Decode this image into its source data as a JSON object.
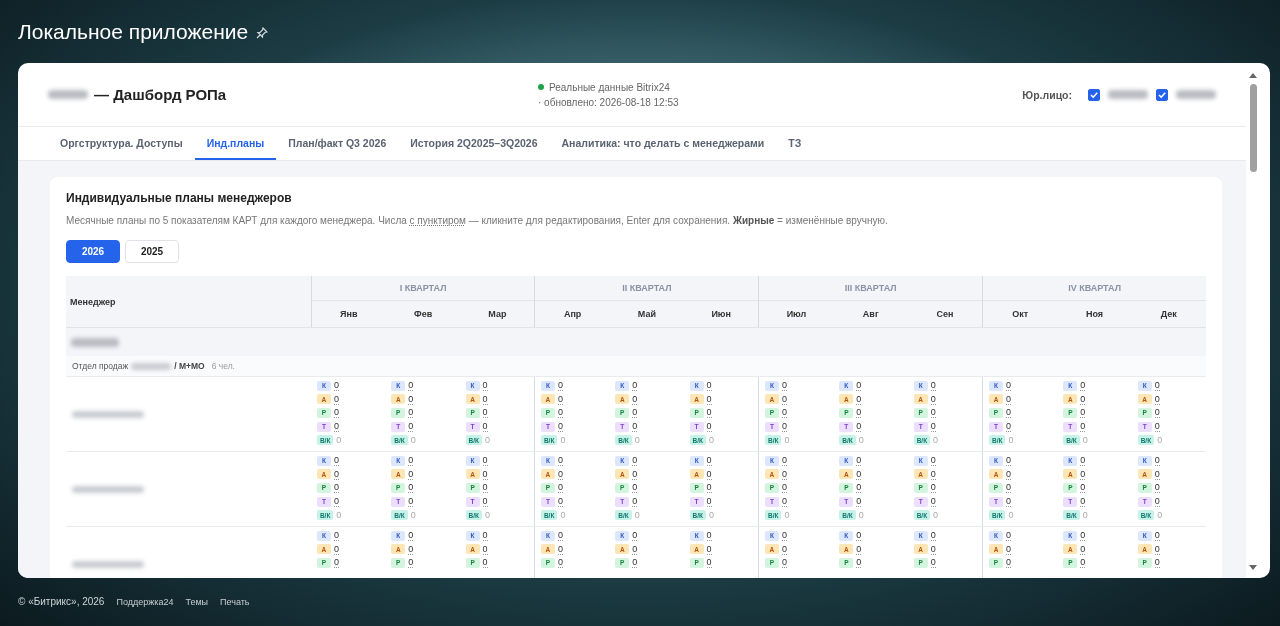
{
  "page_title": "Локальное приложение",
  "header": {
    "title": "— Дашборд РОПа",
    "status": {
      "text": "Реальные данные Bitrix24",
      "color": "#1fa34a"
    },
    "updated": "· обновлено: 2026-08-18 12:53",
    "legal_label": "Юр.лицо:",
    "legal_entities": [
      {
        "checked": true
      },
      {
        "checked": true
      }
    ]
  },
  "tabs": [
    {
      "label": "Оргструктура. Доступы",
      "selected": false
    },
    {
      "label": "Инд.планы",
      "selected": true
    },
    {
      "label": "План/факт Q3 2026",
      "selected": false
    },
    {
      "label": "История 2Q2025–3Q2026",
      "selected": false
    },
    {
      "label": "Аналитика: что делать с менеджерами",
      "selected": false
    },
    {
      "label": "ТЗ",
      "selected": false
    }
  ],
  "panel": {
    "title": "Индивидуальные планы менеджеров",
    "description": [
      {
        "kind": "plain",
        "text": "Месячные планы по 5 показателям КАРТ для каждого менеджера. Числа "
      },
      {
        "kind": "dotted",
        "text": "с пунктиром"
      },
      {
        "kind": "plain",
        "text": " — кликните для редактирования, Enter для сохранения. "
      },
      {
        "kind": "bold",
        "text": "Жирные"
      },
      {
        "kind": "plain",
        "text": " = изменённые вручную."
      }
    ],
    "years": [
      {
        "label": "2026",
        "selected": true
      },
      {
        "label": "2025",
        "selected": false
      }
    ]
  },
  "table": {
    "manager_header": "Менеджер",
    "quarters": [
      {
        "label": "I КВАРТАЛ",
        "months": [
          "Янв",
          "Фев",
          "Мар"
        ]
      },
      {
        "label": "II КВАРТАЛ",
        "months": [
          "Апр",
          "Май",
          "Июн"
        ]
      },
      {
        "label": "III КВАРТАЛ",
        "months": [
          "Июл",
          "Авг",
          "Сен"
        ]
      },
      {
        "label": "IV КВАРТАЛ",
        "months": [
          "Окт",
          "Ноя",
          "Дек"
        ]
      }
    ],
    "department": {
      "prefix": "Отдел продаж",
      "suffix": "/ М+МО",
      "count": "6 чел."
    },
    "managers": [
      {
        "months": [
          [
            {
              "kind": "k",
              "label": "К",
              "value": "0"
            },
            {
              "kind": "a",
              "label": "А",
              "value": "0"
            },
            {
              "kind": "r",
              "label": "Р",
              "value": "0"
            },
            {
              "kind": "t",
              "label": "Т",
              "value": "0"
            },
            {
              "kind": "vk",
              "label": "В/К",
              "value": "0"
            }
          ],
          [
            {
              "kind": "k",
              "label": "К",
              "value": "0"
            },
            {
              "kind": "a",
              "label": "А",
              "value": "0"
            },
            {
              "kind": "r",
              "label": "Р",
              "value": "0"
            },
            {
              "kind": "t",
              "label": "Т",
              "value": "0"
            },
            {
              "kind": "vk",
              "label": "В/К",
              "value": "0"
            }
          ],
          [
            {
              "kind": "k",
              "label": "К",
              "value": "0"
            },
            {
              "kind": "a",
              "label": "А",
              "value": "0"
            },
            {
              "kind": "r",
              "label": "Р",
              "value": "0"
            },
            {
              "kind": "t",
              "label": "Т",
              "value": "0"
            },
            {
              "kind": "vk",
              "label": "В/К",
              "value": "0"
            }
          ],
          [
            {
              "kind": "k",
              "label": "К",
              "value": "0"
            },
            {
              "kind": "a",
              "label": "А",
              "value": "0"
            },
            {
              "kind": "r",
              "label": "Р",
              "value": "0"
            },
            {
              "kind": "t",
              "label": "Т",
              "value": "0"
            },
            {
              "kind": "vk",
              "label": "В/К",
              "value": "0"
            }
          ],
          [
            {
              "kind": "k",
              "label": "К",
              "value": "0"
            },
            {
              "kind": "a",
              "label": "А",
              "value": "0"
            },
            {
              "kind": "r",
              "label": "Р",
              "value": "0"
            },
            {
              "kind": "t",
              "label": "Т",
              "value": "0"
            },
            {
              "kind": "vk",
              "label": "В/К",
              "value": "0"
            }
          ],
          [
            {
              "kind": "k",
              "label": "К",
              "value": "0"
            },
            {
              "kind": "a",
              "label": "А",
              "value": "0"
            },
            {
              "kind": "r",
              "label": "Р",
              "value": "0"
            },
            {
              "kind": "t",
              "label": "Т",
              "value": "0"
            },
            {
              "kind": "vk",
              "label": "В/К",
              "value": "0"
            }
          ],
          [
            {
              "kind": "k",
              "label": "К",
              "value": "0"
            },
            {
              "kind": "a",
              "label": "А",
              "value": "0"
            },
            {
              "kind": "r",
              "label": "Р",
              "value": "0"
            },
            {
              "kind": "t",
              "label": "Т",
              "value": "0"
            },
            {
              "kind": "vk",
              "label": "В/К",
              "value": "0"
            }
          ],
          [
            {
              "kind": "k",
              "label": "К",
              "value": "0"
            },
            {
              "kind": "a",
              "label": "А",
              "value": "0"
            },
            {
              "kind": "r",
              "label": "Р",
              "value": "0"
            },
            {
              "kind": "t",
              "label": "Т",
              "value": "0"
            },
            {
              "kind": "vk",
              "label": "В/К",
              "value": "0"
            }
          ],
          [
            {
              "kind": "k",
              "label": "К",
              "value": "0"
            },
            {
              "kind": "a",
              "label": "А",
              "value": "0"
            },
            {
              "kind": "r",
              "label": "Р",
              "value": "0"
            },
            {
              "kind": "t",
              "label": "Т",
              "value": "0"
            },
            {
              "kind": "vk",
              "label": "В/К",
              "value": "0"
            }
          ],
          [
            {
              "kind": "k",
              "label": "К",
              "value": "0"
            },
            {
              "kind": "a",
              "label": "А",
              "value": "0"
            },
            {
              "kind": "r",
              "label": "Р",
              "value": "0"
            },
            {
              "kind": "t",
              "label": "Т",
              "value": "0"
            },
            {
              "kind": "vk",
              "label": "В/К",
              "value": "0"
            }
          ],
          [
            {
              "kind": "k",
              "label": "К",
              "value": "0"
            },
            {
              "kind": "a",
              "label": "А",
              "value": "0"
            },
            {
              "kind": "r",
              "label": "Р",
              "value": "0"
            },
            {
              "kind": "t",
              "label": "Т",
              "value": "0"
            },
            {
              "kind": "vk",
              "label": "В/К",
              "value": "0"
            }
          ],
          [
            {
              "kind": "k",
              "label": "К",
              "value": "0"
            },
            {
              "kind": "a",
              "label": "А",
              "value": "0"
            },
            {
              "kind": "r",
              "label": "Р",
              "value": "0"
            },
            {
              "kind": "t",
              "label": "Т",
              "value": "0"
            },
            {
              "kind": "vk",
              "label": "В/К",
              "value": "0"
            }
          ]
        ]
      },
      {
        "months": [
          [
            {
              "kind": "k",
              "label": "К",
              "value": "0"
            },
            {
              "kind": "a",
              "label": "А",
              "value": "0"
            },
            {
              "kind": "r",
              "label": "Р",
              "value": "0"
            },
            {
              "kind": "t",
              "label": "Т",
              "value": "0"
            },
            {
              "kind": "vk",
              "label": "В/К",
              "value": "0"
            }
          ],
          [
            {
              "kind": "k",
              "label": "К",
              "value": "0"
            },
            {
              "kind": "a",
              "label": "А",
              "value": "0"
            },
            {
              "kind": "r",
              "label": "Р",
              "value": "0"
            },
            {
              "kind": "t",
              "label": "Т",
              "value": "0"
            },
            {
              "kind": "vk",
              "label": "В/К",
              "value": "0"
            }
          ],
          [
            {
              "kind": "k",
              "label": "К",
              "value": "0"
            },
            {
              "kind": "a",
              "label": "А",
              "value": "0"
            },
            {
              "kind": "r",
              "label": "Р",
              "value": "0"
            },
            {
              "kind": "t",
              "label": "Т",
              "value": "0"
            },
            {
              "kind": "vk",
              "label": "В/К",
              "value": "0"
            }
          ],
          [
            {
              "kind": "k",
              "label": "К",
              "value": "0"
            },
            {
              "kind": "a",
              "label": "А",
              "value": "0"
            },
            {
              "kind": "r",
              "label": "Р",
              "value": "0"
            },
            {
              "kind": "t",
              "label": "Т",
              "value": "0"
            },
            {
              "kind": "vk",
              "label": "В/К",
              "value": "0"
            }
          ],
          [
            {
              "kind": "k",
              "label": "К",
              "value": "0"
            },
            {
              "kind": "a",
              "label": "А",
              "value": "0"
            },
            {
              "kind": "r",
              "label": "Р",
              "value": "0"
            },
            {
              "kind": "t",
              "label": "Т",
              "value": "0"
            },
            {
              "kind": "vk",
              "label": "В/К",
              "value": "0"
            }
          ],
          [
            {
              "kind": "k",
              "label": "К",
              "value": "0"
            },
            {
              "kind": "a",
              "label": "А",
              "value": "0"
            },
            {
              "kind": "r",
              "label": "Р",
              "value": "0"
            },
            {
              "kind": "t",
              "label": "Т",
              "value": "0"
            },
            {
              "kind": "vk",
              "label": "В/К",
              "value": "0"
            }
          ],
          [
            {
              "kind": "k",
              "label": "К",
              "value": "0"
            },
            {
              "kind": "a",
              "label": "А",
              "value": "0"
            },
            {
              "kind": "r",
              "label": "Р",
              "value": "0"
            },
            {
              "kind": "t",
              "label": "Т",
              "value": "0"
            },
            {
              "kind": "vk",
              "label": "В/К",
              "value": "0"
            }
          ],
          [
            {
              "kind": "k",
              "label": "К",
              "value": "0"
            },
            {
              "kind": "a",
              "label": "А",
              "value": "0"
            },
            {
              "kind": "r",
              "label": "Р",
              "value": "0"
            },
            {
              "kind": "t",
              "label": "Т",
              "value": "0"
            },
            {
              "kind": "vk",
              "label": "В/К",
              "value": "0"
            }
          ],
          [
            {
              "kind": "k",
              "label": "К",
              "value": "0"
            },
            {
              "kind": "a",
              "label": "А",
              "value": "0"
            },
            {
              "kind": "r",
              "label": "Р",
              "value": "0"
            },
            {
              "kind": "t",
              "label": "Т",
              "value": "0"
            },
            {
              "kind": "vk",
              "label": "В/К",
              "value": "0"
            }
          ],
          [
            {
              "kind": "k",
              "label": "К",
              "value": "0"
            },
            {
              "kind": "a",
              "label": "А",
              "value": "0"
            },
            {
              "kind": "r",
              "label": "Р",
              "value": "0"
            },
            {
              "kind": "t",
              "label": "Т",
              "value": "0"
            },
            {
              "kind": "vk",
              "label": "В/К",
              "value": "0"
            }
          ],
          [
            {
              "kind": "k",
              "label": "К",
              "value": "0"
            },
            {
              "kind": "a",
              "label": "А",
              "value": "0"
            },
            {
              "kind": "r",
              "label": "Р",
              "value": "0"
            },
            {
              "kind": "t",
              "label": "Т",
              "value": "0"
            },
            {
              "kind": "vk",
              "label": "В/К",
              "value": "0"
            }
          ],
          [
            {
              "kind": "k",
              "label": "К",
              "value": "0"
            },
            {
              "kind": "a",
              "label": "А",
              "value": "0"
            },
            {
              "kind": "r",
              "label": "Р",
              "value": "0"
            },
            {
              "kind": "t",
              "label": "Т",
              "value": "0"
            },
            {
              "kind": "vk",
              "label": "В/К",
              "value": "0"
            }
          ]
        ]
      },
      {
        "months": [
          [
            {
              "kind": "k",
              "label": "К",
              "value": "0"
            },
            {
              "kind": "a",
              "label": "А",
              "value": "0"
            },
            {
              "kind": "r",
              "label": "Р",
              "value": "0"
            }
          ],
          [
            {
              "kind": "k",
              "label": "К",
              "value": "0"
            },
            {
              "kind": "a",
              "label": "А",
              "value": "0"
            },
            {
              "kind": "r",
              "label": "Р",
              "value": "0"
            }
          ],
          [
            {
              "kind": "k",
              "label": "К",
              "value": "0"
            },
            {
              "kind": "a",
              "label": "А",
              "value": "0"
            },
            {
              "kind": "r",
              "label": "Р",
              "value": "0"
            }
          ],
          [
            {
              "kind": "k",
              "label": "К",
              "value": "0"
            },
            {
              "kind": "a",
              "label": "А",
              "value": "0"
            },
            {
              "kind": "r",
              "label": "Р",
              "value": "0"
            }
          ],
          [
            {
              "kind": "k",
              "label": "К",
              "value": "0"
            },
            {
              "kind": "a",
              "label": "А",
              "value": "0"
            },
            {
              "kind": "r",
              "label": "Р",
              "value": "0"
            }
          ],
          [
            {
              "kind": "k",
              "label": "К",
              "value": "0"
            },
            {
              "kind": "a",
              "label": "А",
              "value": "0"
            },
            {
              "kind": "r",
              "label": "Р",
              "value": "0"
            }
          ],
          [
            {
              "kind": "k",
              "label": "К",
              "value": "0"
            },
            {
              "kind": "a",
              "label": "А",
              "value": "0"
            },
            {
              "kind": "r",
              "label": "Р",
              "value": "0"
            }
          ],
          [
            {
              "kind": "k",
              "label": "К",
              "value": "0"
            },
            {
              "kind": "a",
              "label": "А",
              "value": "0"
            },
            {
              "kind": "r",
              "label": "Р",
              "value": "0"
            }
          ],
          [
            {
              "kind": "k",
              "label": "К",
              "value": "0"
            },
            {
              "kind": "a",
              "label": "А",
              "value": "0"
            },
            {
              "kind": "r",
              "label": "Р",
              "value": "0"
            }
          ],
          [
            {
              "kind": "k",
              "label": "К",
              "value": "0"
            },
            {
              "kind": "a",
              "label": "А",
              "value": "0"
            },
            {
              "kind": "r",
              "label": "Р",
              "value": "0"
            }
          ],
          [
            {
              "kind": "k",
              "label": "К",
              "value": "0"
            },
            {
              "kind": "a",
              "label": "А",
              "value": "0"
            },
            {
              "kind": "r",
              "label": "Р",
              "value": "0"
            }
          ],
          [
            {
              "kind": "k",
              "label": "К",
              "value": "0"
            },
            {
              "kind": "a",
              "label": "А",
              "value": "0"
            },
            {
              "kind": "r",
              "label": "Р",
              "value": "0"
            }
          ]
        ]
      }
    ]
  },
  "footer": {
    "copyright": "© «Битрикс», 2026",
    "links": [
      "Поддержка24",
      "Темы",
      "Печать"
    ]
  }
}
